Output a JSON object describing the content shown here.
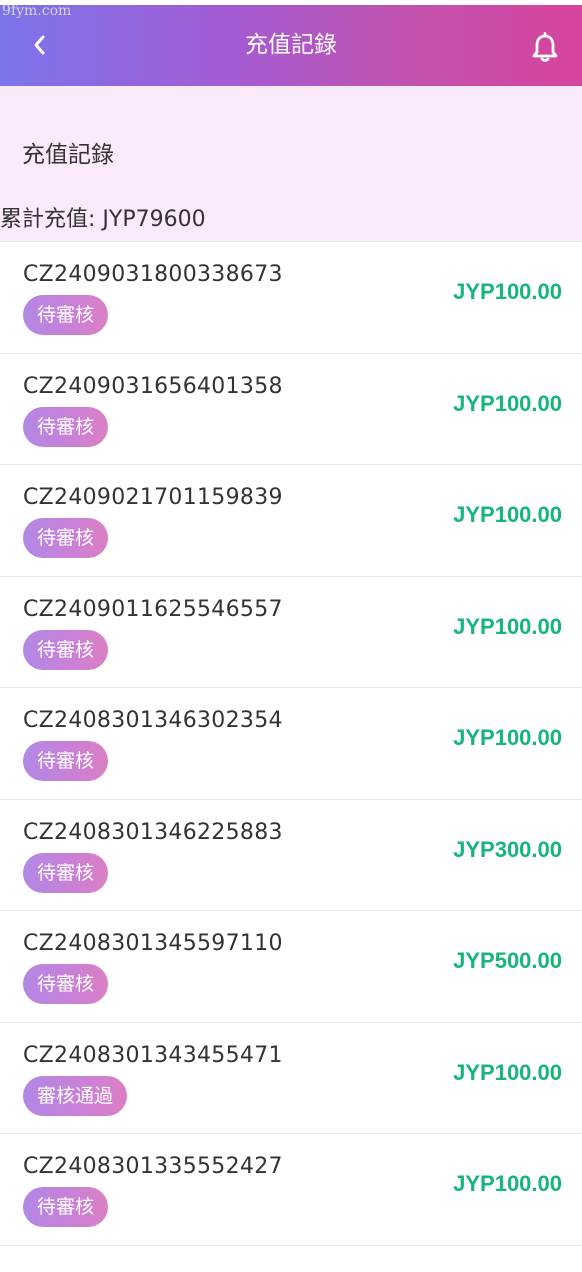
{
  "watermark": "9fym.com",
  "header": {
    "title": "充值記錄",
    "back_icon": "chevron-left-icon",
    "bell_icon": "bell-icon"
  },
  "summary": {
    "title": "充值記錄",
    "total_text": "累計充值: JYP79600"
  },
  "colors": {
    "header_gradient_start": "#7b74ec",
    "header_gradient_end": "#d6439e",
    "summary_bg": "#fbe9fc",
    "amount": "#16b579",
    "badge_gradient_start": "#b188e5",
    "badge_gradient_end": "#db7fc4"
  },
  "records": [
    {
      "id": "CZ2409031800338673",
      "status": "待審核",
      "amount": "JYP100.00"
    },
    {
      "id": "CZ2409031656401358",
      "status": "待審核",
      "amount": "JYP100.00"
    },
    {
      "id": "CZ2409021701159839",
      "status": "待審核",
      "amount": "JYP100.00"
    },
    {
      "id": "CZ2409011625546557",
      "status": "待審核",
      "amount": "JYP100.00"
    },
    {
      "id": "CZ2408301346302354",
      "status": "待審核",
      "amount": "JYP100.00"
    },
    {
      "id": "CZ2408301346225883",
      "status": "待審核",
      "amount": "JYP300.00"
    },
    {
      "id": "CZ2408301345597110",
      "status": "待審核",
      "amount": "JYP500.00"
    },
    {
      "id": "CZ2408301343455471",
      "status": "審核通過",
      "amount": "JYP100.00"
    },
    {
      "id": "CZ2408301335552427",
      "status": "待審核",
      "amount": "JYP100.00"
    }
  ]
}
